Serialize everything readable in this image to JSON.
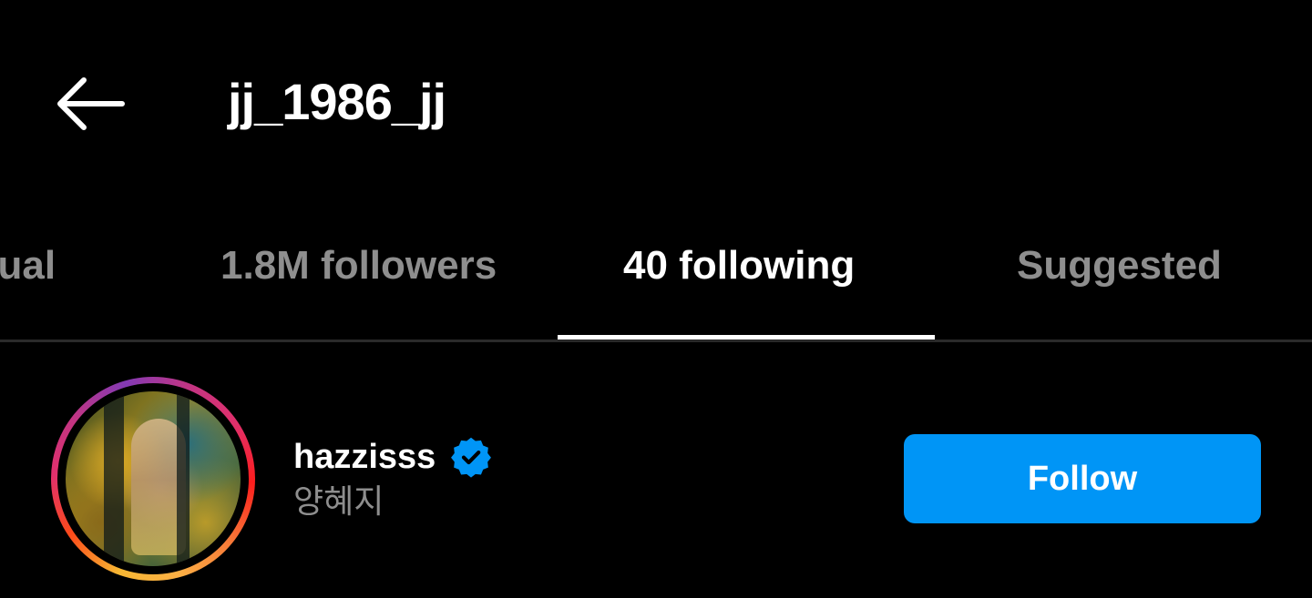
{
  "header": {
    "title": "jj_1986_jj",
    "back_icon": "arrow-left-icon"
  },
  "tabs": [
    {
      "label": "Mutual",
      "visible_label": "utual",
      "active": false
    },
    {
      "label": "1.8M followers",
      "active": false
    },
    {
      "label": "40 following",
      "active": true
    },
    {
      "label": "Suggested",
      "active": false
    }
  ],
  "list": {
    "items": [
      {
        "username": "hazzisss",
        "verified": true,
        "full_name": "양혜지",
        "button_label": "Follow",
        "avatar_icon": "story-ring-avatar"
      }
    ]
  },
  "colors": {
    "background": "#000000",
    "text_primary": "#ffffff",
    "text_secondary": "#8e8e8e",
    "accent": "#0095f6",
    "verified": "#0095f6"
  }
}
